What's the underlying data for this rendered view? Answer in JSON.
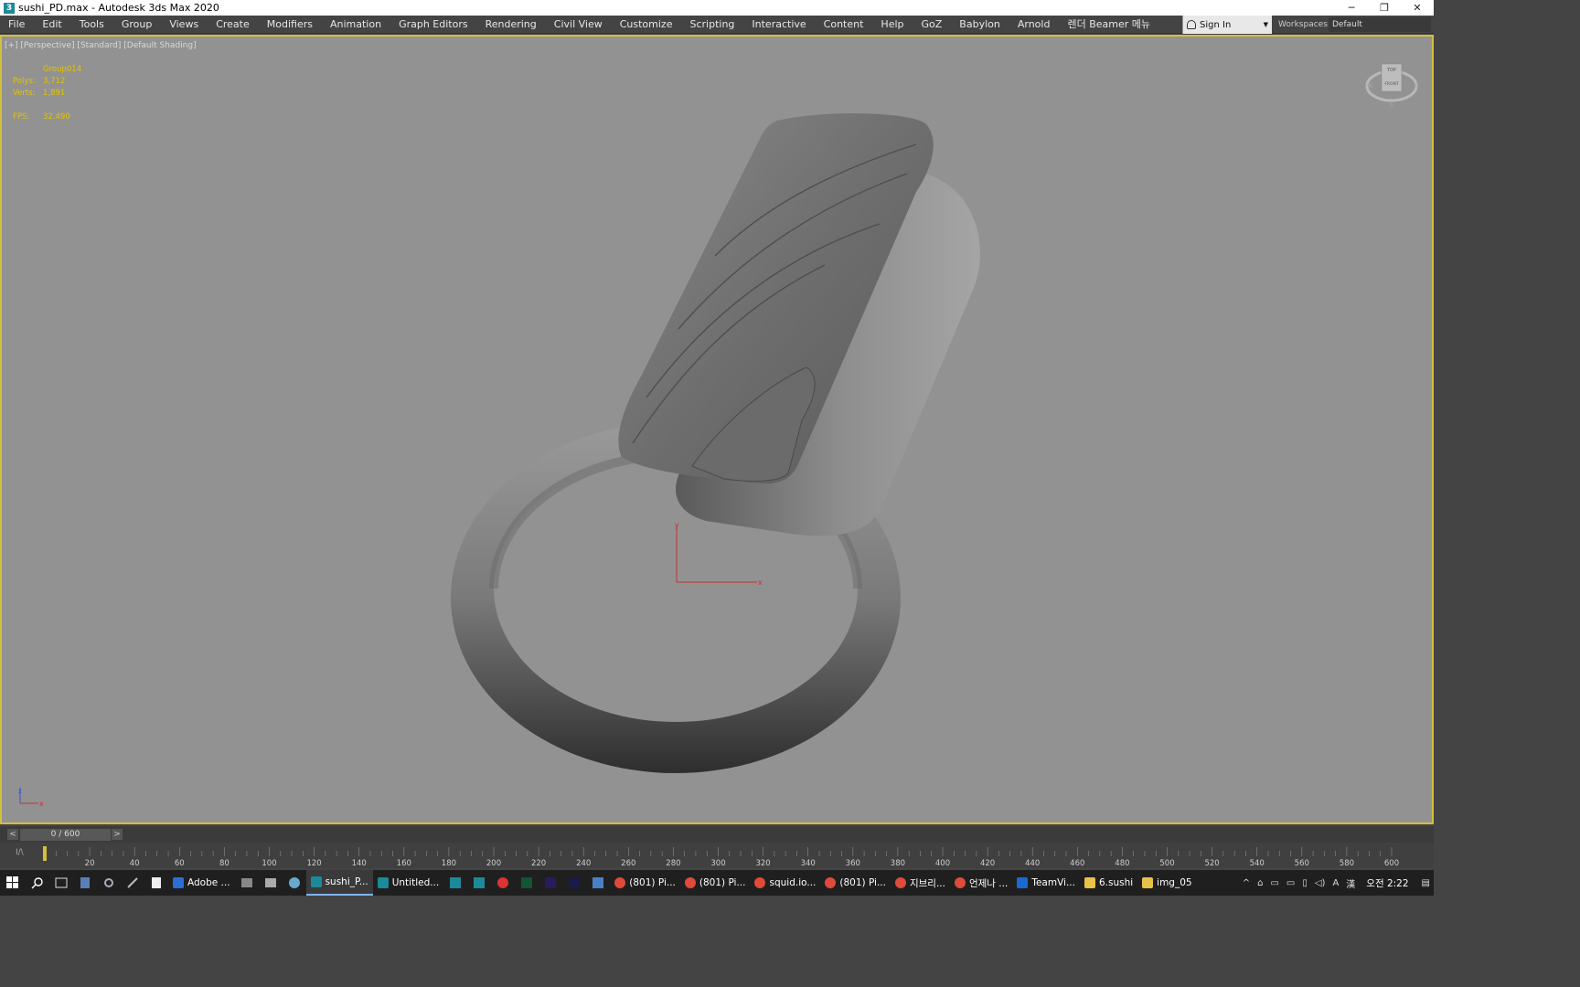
{
  "window": {
    "title": "sushi_PD.max - Autodesk 3ds Max 2020",
    "app_icon_letter": "3",
    "minimize": "─",
    "restore": "❐",
    "close": "✕"
  },
  "menu": {
    "items": [
      "File",
      "Edit",
      "Tools",
      "Group",
      "Views",
      "Create",
      "Modifiers",
      "Animation",
      "Graph Editors",
      "Rendering",
      "Civil View",
      "Customize",
      "Scripting",
      "Interactive",
      "Content",
      "Help",
      "GoZ",
      "Babylon",
      "Arnold",
      "렌더 Beamer 메뉴"
    ],
    "sign_in": "Sign In",
    "workspaces_label": "Workspaces:",
    "workspace_value": "Default"
  },
  "viewport": {
    "label": "[+] [Perspective] [Standard] [Default Shading]",
    "stats": {
      "object": "Group014",
      "polys_label": "Polys:",
      "polys_value": "3,712",
      "verts_label": "Verts:",
      "verts_value": "1,891",
      "fps_label": "FPS:",
      "fps_value": "32.490"
    },
    "viewcube": {
      "top": "TOP",
      "front": "FRONT",
      "w": "W",
      "e": "E",
      "s": "S"
    },
    "gizmo": {
      "x": "x",
      "y": "y"
    },
    "axis": {
      "x": "x",
      "z": "z"
    }
  },
  "timeline": {
    "frame_display": "0 / 600",
    "prev": "<",
    "next": ">",
    "track_icon": "I/\\",
    "ticks": [
      "20",
      "40",
      "60",
      "80",
      "100",
      "120",
      "140",
      "160",
      "180",
      "200",
      "220",
      "240",
      "260",
      "280",
      "300",
      "320",
      "340",
      "360",
      "380",
      "400",
      "420",
      "440",
      "460",
      "480",
      "500",
      "520",
      "540",
      "560",
      "580",
      "600"
    ]
  },
  "taskbar": {
    "apps": [
      {
        "label": "Adobe ...",
        "color": "#2a6fd6"
      },
      {
        "label": "sushi_P...",
        "color": "#1b8a9a",
        "active": true
      },
      {
        "label": "Untitled...",
        "color": "#1b8a9a"
      },
      {
        "label": "(801) Pi...",
        "color": "#e04a3a"
      },
      {
        "label": "(801) Pi...",
        "color": "#e04a3a"
      },
      {
        "label": "squid.io...",
        "color": "#e04a3a"
      },
      {
        "label": "(801) Pi...",
        "color": "#e04a3a"
      },
      {
        "label": "지브리...",
        "color": "#e04a3a"
      },
      {
        "label": "언제나 ...",
        "color": "#e04a3a"
      },
      {
        "label": "TeamVi...",
        "color": "#1a6bd1"
      },
      {
        "label": "6.sushi",
        "color": "#e8c14a"
      },
      {
        "label": "img_05",
        "color": "#e8c14a"
      }
    ],
    "clock": "오전 2:22",
    "tray_lang": "A",
    "tray_ime": "漢"
  }
}
